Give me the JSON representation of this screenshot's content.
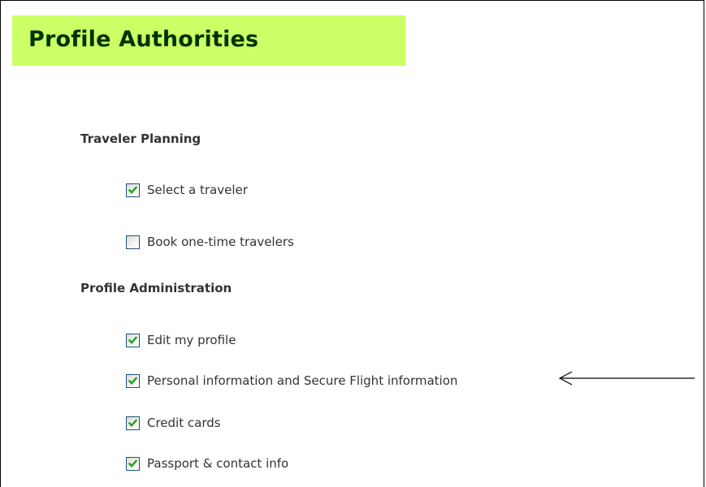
{
  "page": {
    "title": "Profile Authorities"
  },
  "sections": [
    {
      "heading": "Traveler Planning",
      "options": [
        {
          "label": "Select a traveler",
          "checked": true
        },
        {
          "label": "Book one-time travelers",
          "checked": false
        }
      ]
    },
    {
      "heading": "Profile Administration",
      "options": [
        {
          "label": "Edit my profile",
          "checked": true
        },
        {
          "label": "Personal information and Secure Flight information",
          "checked": true
        },
        {
          "label": "Credit cards",
          "checked": true
        },
        {
          "label": "Passport & contact info",
          "checked": true
        }
      ]
    }
  ],
  "colors": {
    "title_background": "#ccff66",
    "title_text": "#003300",
    "checkmark": "#21a121",
    "checkbox_border": "#1c5180"
  },
  "annotation": {
    "icon": "left-arrow-icon",
    "points_to": "Personal information and Secure Flight information"
  }
}
